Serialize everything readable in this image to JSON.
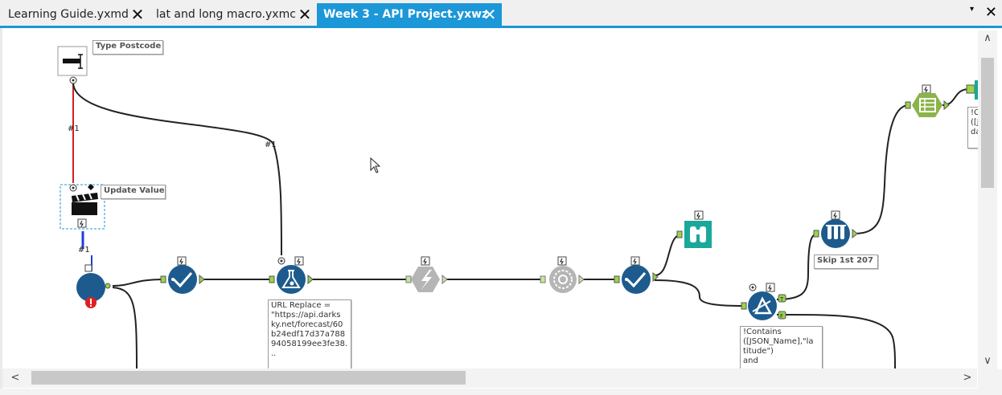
{
  "tabs": [
    {
      "label": "Learning Guide.yxmd",
      "close": "✕",
      "active": false
    },
    {
      "label": "lat and long macro.yxmc",
      "close": "✕",
      "active": false
    },
    {
      "label": "Week 3 - API Project.yxwz",
      "close": "✕",
      "active": true
    }
  ],
  "tab_menu_icon": "▾",
  "window_close": "✕",
  "colors": {
    "accent": "#1c97d8",
    "tool_blue": "#1d5b8e",
    "tool_teal": "#1aa89a",
    "tool_green": "#8bb449",
    "tool_grey": "#b5b5b5",
    "error_red": "#e02020",
    "connector_red": "#d42020",
    "connector_blue": "#1f3fd6"
  },
  "annotations": {
    "type_postcode": "Type Postcode",
    "update_value": "Update Value",
    "url_replace": "URL Replace =\n\"https://api.darks\nky.net/forecast/60\nb24edf17d37a788\n94058199ee3fe38.\n..",
    "skip": "Skip 1st 207",
    "contains": "!Contains\n([JSON_Name],\"la\ntitude\")\nand",
    "right_cut": "!C\n([J\nda"
  },
  "connection_labels": {
    "red_link": "#1",
    "grey_link": "#1",
    "blue_link": "#1"
  },
  "icons": {
    "textbox": "text-box-icon",
    "action": "clapperboard-icon",
    "macro_input": "macro-input-icon",
    "select": "select-checkmark-icon",
    "formula": "formula-flask-icon",
    "download": "download-lightning-icon",
    "json_parse": "json-parse-icon",
    "browse": "binoculars-icon",
    "filter": "filter-delta-icon",
    "sample": "sample-tubes-icon",
    "crosstab": "crosstab-table-icon",
    "error": "error-icon",
    "lightning": "lightning-badge-icon"
  },
  "scrollbars": {
    "up": "∧",
    "down": "∨",
    "left": "<",
    "right": ">"
  }
}
